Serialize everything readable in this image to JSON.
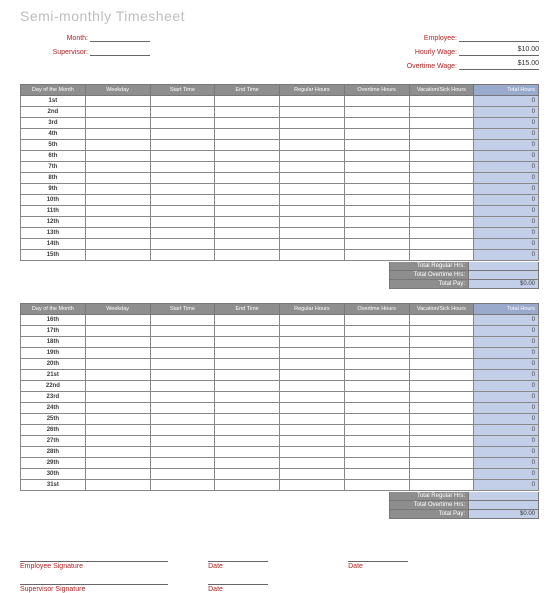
{
  "title": "Semi-monthly Timesheet",
  "fields": {
    "month_label": "Month:",
    "supervisor_label": "Supervisor:",
    "employee_label": "Employee:",
    "hourly_wage_label": "Hourly Wage:",
    "overtime_wage_label": "Overtime Wage:",
    "hourly_wage_value": "$10.00",
    "overtime_wage_value": "$15.00"
  },
  "columns": {
    "day": "Day of the Month",
    "weekday": "Weekday",
    "start": "Start Time",
    "end": "End Time",
    "regular": "Regular Hours",
    "overtime": "Overtime Hours",
    "vacation": "Vacation/Sick Hours",
    "total": "Total Hours"
  },
  "table1_days": [
    "1st",
    "2nd",
    "3rd",
    "4th",
    "5th",
    "6th",
    "7th",
    "8th",
    "9th",
    "10th",
    "11th",
    "12th",
    "13th",
    "14th",
    "15th"
  ],
  "table2_days": [
    "16th",
    "17th",
    "18th",
    "19th",
    "20th",
    "21st",
    "22nd",
    "23rd",
    "24th",
    "25th",
    "26th",
    "27th",
    "28th",
    "29th",
    "30th",
    "31st"
  ],
  "row_total": "0",
  "summary": {
    "regular_label": "Total Regular Hrs:",
    "overtime_label": "Total Overtime Hrs:",
    "pay_label": "Total Pay:",
    "regular_value": "",
    "overtime_value": "",
    "pay_value": "$0.00"
  },
  "signatures": {
    "employee": "Employee Signature",
    "supervisor": "Supervisor Signature",
    "date": "Date"
  }
}
